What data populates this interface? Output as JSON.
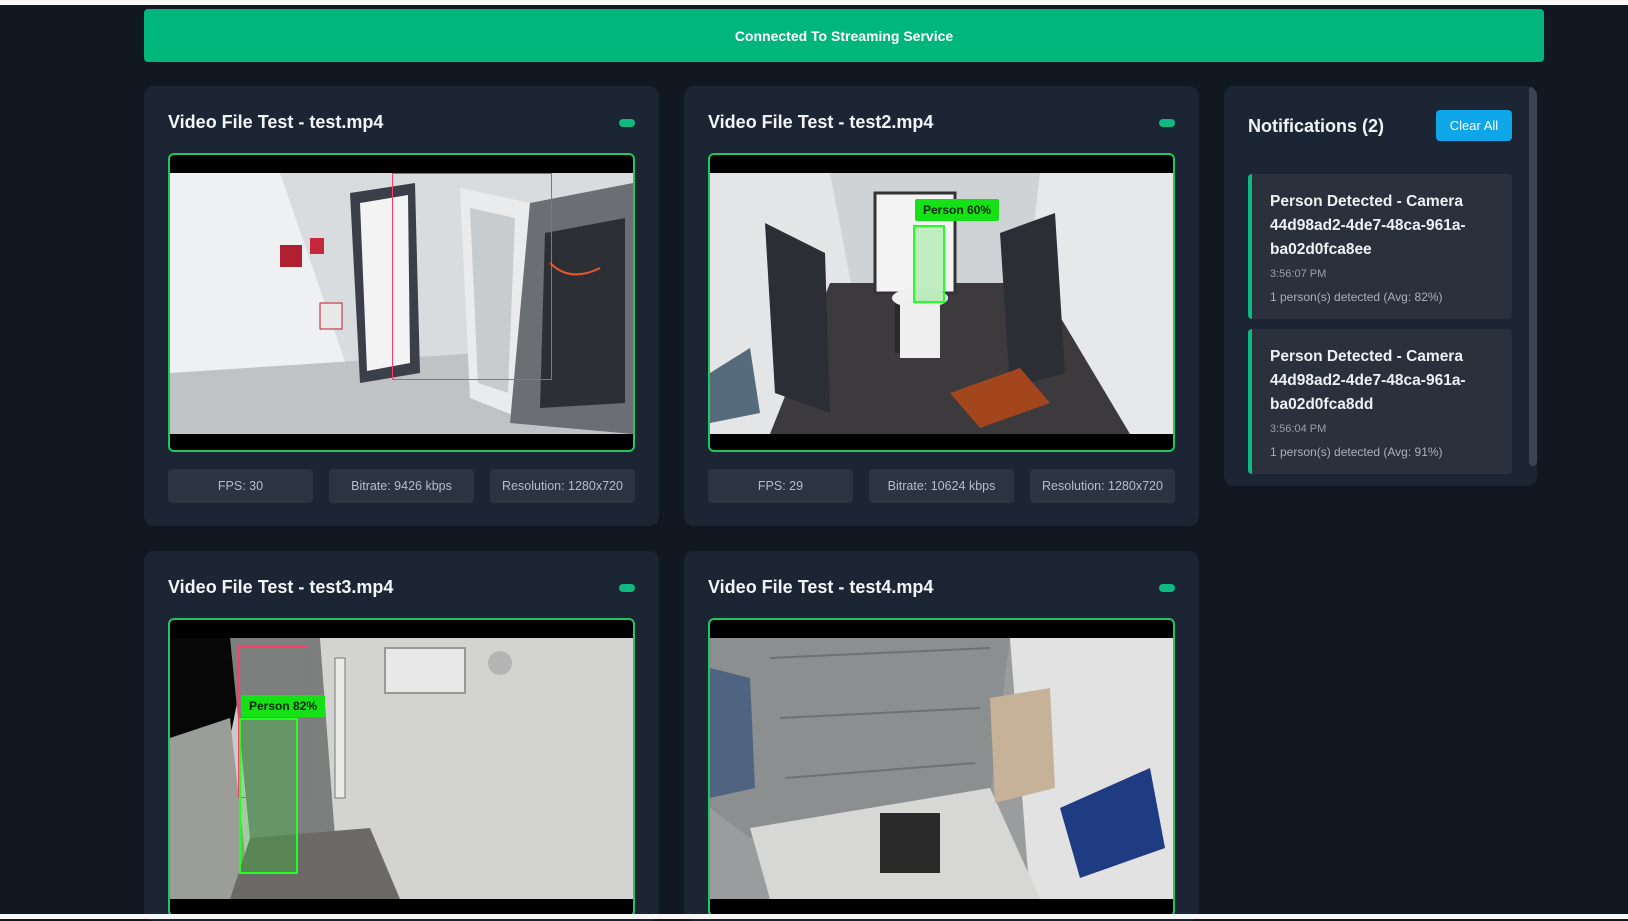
{
  "banner": {
    "text": "Connected To Streaming Service"
  },
  "cameras": [
    {
      "title": "Video File Test - test.mp4",
      "fps": "FPS: 30",
      "bitrate": "Bitrate: 9426 kbps",
      "resolution": "Resolution: 1280x720",
      "detection": ""
    },
    {
      "title": "Video File Test - test2.mp4",
      "fps": "FPS: 29",
      "bitrate": "Bitrate: 10624 kbps",
      "resolution": "Resolution: 1280x720",
      "detection": "Person 60%"
    },
    {
      "title": "Video File Test - test3.mp4",
      "fps": "",
      "bitrate": "",
      "resolution": "",
      "detection": "Person 82%"
    },
    {
      "title": "Video File Test - test4.mp4",
      "fps": "",
      "bitrate": "",
      "resolution": "",
      "detection": ""
    }
  ],
  "notifications": {
    "title": "Notifications (2)",
    "clear_label": "Clear All",
    "items": [
      {
        "heading": "Person Detected - Camera 44d98ad2-4de7-48ca-961a-ba02d0fca8ee",
        "time": "3:56:07 PM",
        "body": "1 person(s) detected (Avg: 82%)"
      },
      {
        "heading": "Person Detected - Camera 44d98ad2-4de7-48ca-961a-ba02d0fca8dd",
        "time": "3:56:04 PM",
        "body": "1 person(s) detected (Avg: 91%)"
      }
    ]
  },
  "colors": {
    "background": "#111821",
    "card": "#1b2534",
    "accent_green": "#00b67a",
    "button_blue": "#0ea5e9",
    "detection_green": "#16e016"
  }
}
